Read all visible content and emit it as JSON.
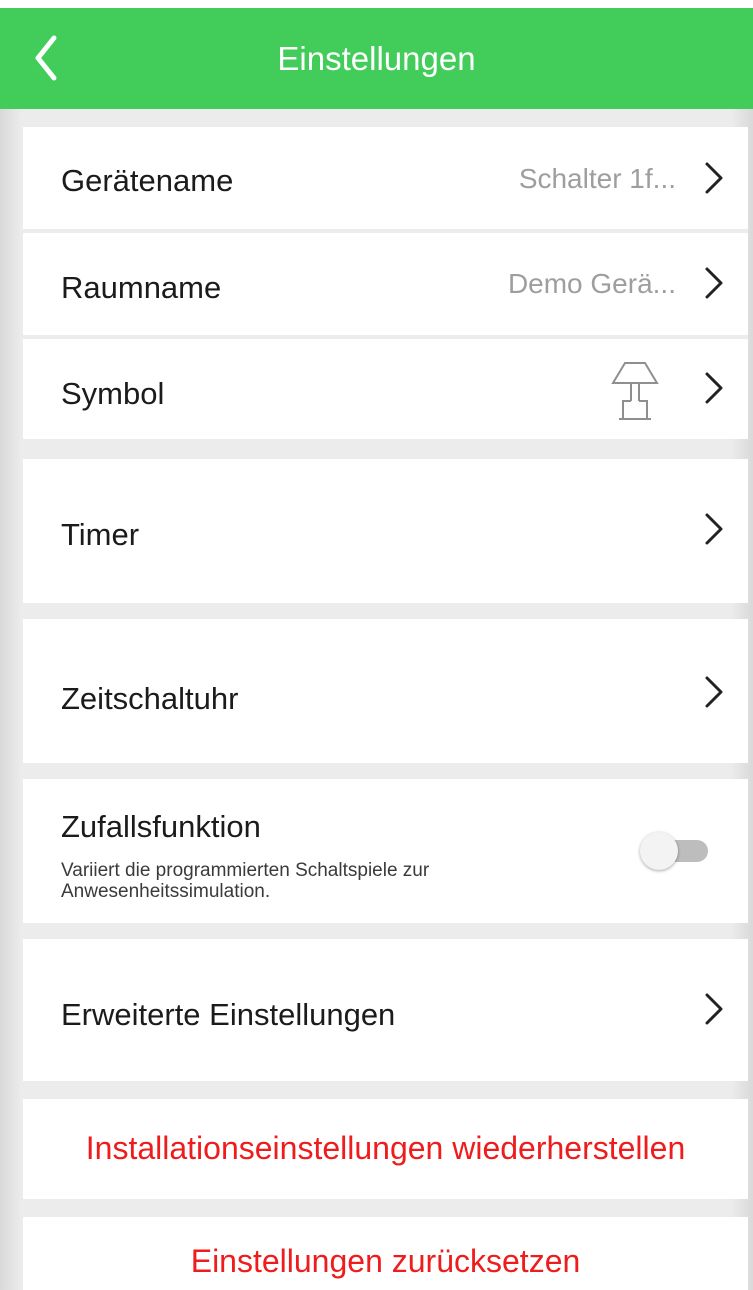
{
  "header": {
    "title": "Einstellungen",
    "back_icon": "chevron-left-icon",
    "color": "#42cc5a"
  },
  "settings": {
    "device_name": {
      "label": "Gerätename",
      "value": "Schalter 1f..."
    },
    "room_name": {
      "label": "Raumname",
      "value": "Demo Gerä..."
    },
    "symbol": {
      "label": "Symbol",
      "icon": "lamp-icon"
    },
    "timer": {
      "label": "Timer"
    },
    "time_switch": {
      "label": "Zeitschaltuhr"
    },
    "random_function": {
      "label": "Zufallsfunktion",
      "description": "Variiert die programmierten Schaltspiele zur Anwesenheitssimulation.",
      "enabled": false
    },
    "advanced": {
      "label": "Erweiterte Einstellungen"
    }
  },
  "actions": {
    "restore_install": "Installationseinstellungen wiederherstellen",
    "reset": "Einstellungen zurücksetzen",
    "danger_color": "#ee1c1c"
  }
}
